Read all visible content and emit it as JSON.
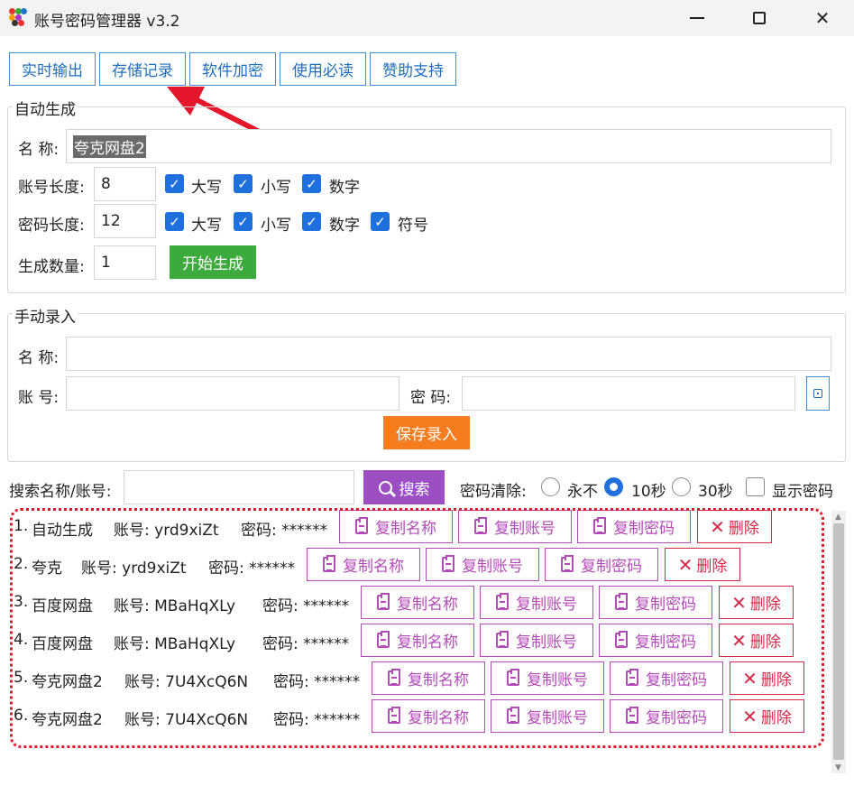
{
  "window": {
    "title": "账号密码管理器 v3.2",
    "minimize": "—",
    "maximize": "☐",
    "close": "✕"
  },
  "tabs": [
    "实时输出",
    "存储记录",
    "软件加密",
    "使用必读",
    "赞助支持"
  ],
  "auto_gen": {
    "group_title": "自动生成",
    "name_label": "名 称:",
    "name_value": "夸克网盘2",
    "acct_len_label": "账号长度:",
    "acct_len_value": "8",
    "acct_opts": [
      "大写",
      "小写",
      "数字"
    ],
    "pwd_len_label": "密码长度:",
    "pwd_len_value": "12",
    "pwd_opts": [
      "大写",
      "小写",
      "数字",
      "符号"
    ],
    "count_label": "生成数量:",
    "count_value": "1",
    "start_button": "开始生成"
  },
  "manual": {
    "group_title": "手动录入",
    "name_label": "名 称:",
    "account_label": "账 号:",
    "password_label": "密 码:",
    "save_button": "保存录入"
  },
  "search": {
    "label": "搜索名称/账号:",
    "button": "搜索",
    "clear_label": "密码清除:",
    "options": [
      "永不",
      "10秒",
      "30秒"
    ],
    "selected": "10秒",
    "show_password": "显示密码"
  },
  "records": [
    {
      "index": "1.",
      "name": "自动生成",
      "account_label": "账号:",
      "account": "yrd9xiZt",
      "pwd_label": "密码:",
      "pwd": "******"
    },
    {
      "index": "2.",
      "name": "夸克",
      "account_label": "账号:",
      "account": "yrd9xiZt",
      "pwd_label": "密码:",
      "pwd": "******"
    },
    {
      "index": "3.",
      "name": "百度网盘",
      "account_label": "账号:",
      "account": "MBaHqXLy",
      "pwd_label": "密码:",
      "pwd": "******"
    },
    {
      "index": "4.",
      "name": "百度网盘",
      "account_label": "账号:",
      "account": "MBaHqXLy",
      "pwd_label": "密码:",
      "pwd": "******"
    },
    {
      "index": "5.",
      "name": "夸克网盘2",
      "account_label": "账号:",
      "account": "7U4XcQ6N",
      "pwd_label": "密码:",
      "pwd": "******"
    },
    {
      "index": "6.",
      "name": "夸克网盘2",
      "account_label": "账号:",
      "account": "7U4XcQ6N",
      "pwd_label": "密码:",
      "pwd": "******"
    }
  ],
  "row_buttons": {
    "copy_name": "复制名称",
    "copy_account": "复制账号",
    "copy_password": "复制密码",
    "delete": "删除"
  },
  "colors": {
    "accent_blue": "#1f6fdd",
    "green": "#3caa3c",
    "orange": "#f57c1f",
    "purple": "#9b4fc2",
    "copy_purple": "#b44ab8",
    "delete_red": "#d8284a",
    "annotation_red": "#e4162b"
  }
}
